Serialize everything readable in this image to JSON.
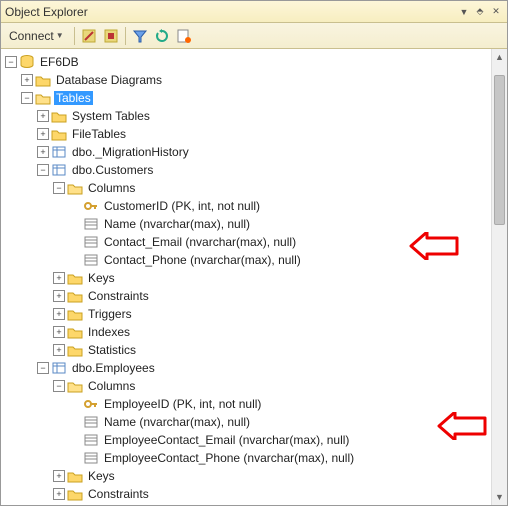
{
  "titlebar": {
    "title": "Object Explorer"
  },
  "toolbar": {
    "connect": "Connect"
  },
  "tree": {
    "db": "EF6DB",
    "diagrams": "Database Diagrams",
    "tables": "Tables",
    "systables": "System Tables",
    "filetables": "FileTables",
    "migration": "dbo._MigrationHistory",
    "customers": "dbo.Customers",
    "columns": "Columns",
    "cust_cols": {
      "c0": "CustomerID (PK, int, not null)",
      "c1": "Name (nvarchar(max), null)",
      "c2": "Contact_Email (nvarchar(max), null)",
      "c3": "Contact_Phone (nvarchar(max), null)"
    },
    "keys": "Keys",
    "constraints": "Constraints",
    "triggers": "Triggers",
    "indexes": "Indexes",
    "statistics": "Statistics",
    "employees": "dbo.Employees",
    "emp_cols": {
      "c0": "EmployeeID (PK, int, not null)",
      "c1": "Name (nvarchar(max), null)",
      "c2": "EmployeeContact_Email (nvarchar(max), null)",
      "c3": "EmployeeContact_Phone (nvarchar(max), null)"
    }
  }
}
